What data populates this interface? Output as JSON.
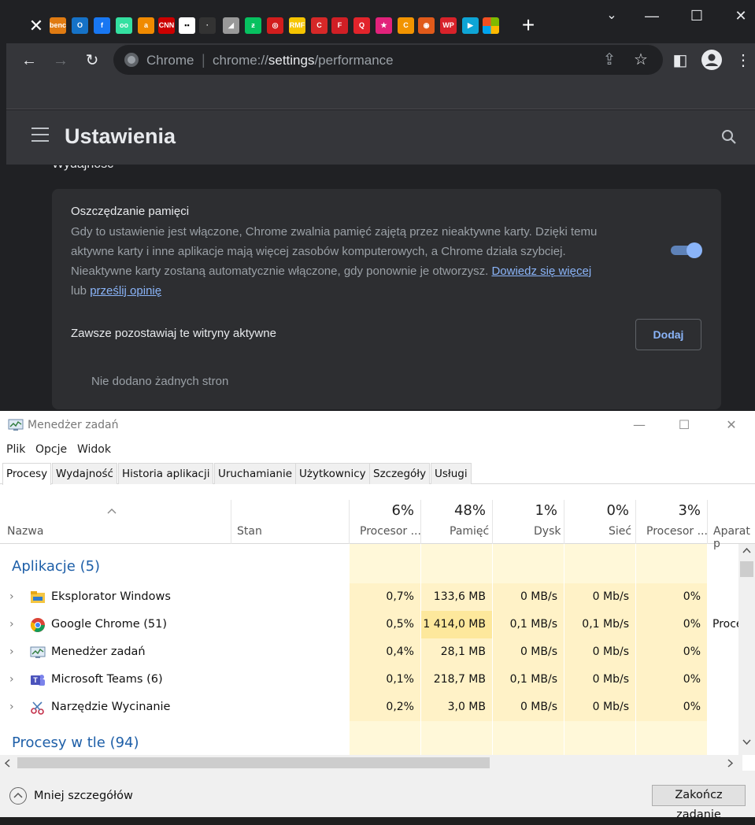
{
  "browser": {
    "window_controls": {
      "dropdown": "⌄",
      "minimize": "—",
      "maximize": "☐",
      "close": "✕"
    },
    "new_tab": "+",
    "tab_close": "✕",
    "tab_favicons": [
      {
        "name": "benchmark-favicon",
        "label": "bench mark",
        "color": "#e07b12"
      },
      {
        "name": "outlook-favicon",
        "label": "O",
        "color": "#1672c7"
      },
      {
        "name": "facebook-favicon",
        "label": "f",
        "color": "#1877f2"
      },
      {
        "name": "tripadvisor-favicon",
        "label": "oo",
        "color": "#34e0a1"
      },
      {
        "name": "amazon-favicon",
        "label": "a",
        "color": "#f08a00"
      },
      {
        "name": "cnn-favicon",
        "label": "CNN",
        "color": "#cc0000"
      },
      {
        "name": "medium-favicon",
        "label": "▪▪",
        "color": "#ffffff"
      },
      {
        "name": "site-favicon-8",
        "label": "·",
        "color": "#333333"
      },
      {
        "name": "site-favicon-9",
        "label": "◢",
        "color": "#999999"
      },
      {
        "name": "site-favicon-10",
        "label": "ƶ",
        "color": "#07c160"
      },
      {
        "name": "radio-favicon",
        "label": "◎",
        "color": "#d21d1d"
      },
      {
        "name": "rmf-favicon",
        "label": "RMF",
        "color": "#f5c400"
      },
      {
        "name": "site-favicon-13",
        "label": "C",
        "color": "#d62828"
      },
      {
        "name": "fakt-favicon",
        "label": "F",
        "color": "#d01f25"
      },
      {
        "name": "site-favicon-15",
        "label": "Q",
        "color": "#e2242b"
      },
      {
        "name": "site-favicon-16",
        "label": "★",
        "color": "#e2227b"
      },
      {
        "name": "site-favicon-17",
        "label": "C",
        "color": "#f29400"
      },
      {
        "name": "site-favicon-18",
        "label": "◉",
        "color": "#e05a1a"
      },
      {
        "name": "wp-favicon",
        "label": "WP",
        "color": "#d8222a"
      },
      {
        "name": "player-favicon",
        "label": "▶",
        "color": "#0ea5d6"
      },
      {
        "name": "microsoft-favicon",
        "label": "",
        "color": "#f25022"
      }
    ],
    "nav": {
      "back": "←",
      "forward": "→",
      "reload": "↻"
    },
    "address": {
      "site_label": "Chrome",
      "separator": "|",
      "scheme": "chrome://",
      "host": "settings",
      "path": "/performance"
    },
    "toolbar_icons": {
      "share": "⇪",
      "star": "☆",
      "sidepanel": "◧",
      "menu": "⋮"
    }
  },
  "settings": {
    "title": "Ustawienia",
    "section_title": "Wydajność",
    "memory_saver": {
      "heading": "Oszczędzanie pamięci",
      "description": "Gdy to ustawienie jest włączone, Chrome zwalnia pamięć zajętą przez nieaktywne karty. Dzięki temu aktywne karty i inne aplikacje mają więcej zasobów komputerowych, a Chrome działa szybciej. Nieaktywne karty zostaną automatycznie włączone, gdy ponownie je otworzysz.",
      "learn_more_link": "Dowiedz się więcej",
      "or_text": "lub",
      "feedback_link": "prześlij opinię",
      "enabled": true
    },
    "always_active": {
      "label": "Zawsze pozostawiaj te witryny aktywne",
      "add_button": "Dodaj",
      "empty_text": "Nie dodano żadnych stron"
    }
  },
  "taskmanager": {
    "title": "Menedżer zadań",
    "window_controls": {
      "minimize": "—",
      "maximize": "☐",
      "close": "✕"
    },
    "menu": [
      "Plik",
      "Opcje",
      "Widok"
    ],
    "tabs": [
      "Procesy",
      "Wydajność",
      "Historia aplikacji",
      "Uruchamianie",
      "Użytkownicy",
      "Szczegóły",
      "Usługi"
    ],
    "active_tab": "Procesy",
    "columns": {
      "name": "Nazwa",
      "status": "Stan",
      "cpu_pct": "6%",
      "cpu": "Procesor ...",
      "mem_pct": "48%",
      "mem": "Pamięć",
      "disk_pct": "1%",
      "disk": "Dysk",
      "net_pct": "0%",
      "net": "Sieć",
      "gpu_pct": "3%",
      "gpu": "Procesor ...",
      "gpu_engine": "Aparat p"
    },
    "groups": {
      "apps": "Aplikacje (5)",
      "background": "Procesy w tle (94)"
    },
    "apps": [
      {
        "name": "Eksplorator Windows",
        "cpu": "0,7%",
        "mem": "133,6 MB",
        "disk": "0 MB/s",
        "net": "0 Mb/s",
        "gpu": "0%",
        "gpu_engine": ""
      },
      {
        "name": "Google Chrome (51)",
        "cpu": "0,5%",
        "mem": "1 414,0 MB",
        "disk": "0,1 MB/s",
        "net": "0,1 Mb/s",
        "gpu": "0%",
        "gpu_engine": "Proce"
      },
      {
        "name": "Menedżer zadań",
        "cpu": "0,4%",
        "mem": "28,1 MB",
        "disk": "0 MB/s",
        "net": "0 Mb/s",
        "gpu": "0%",
        "gpu_engine": ""
      },
      {
        "name": "Microsoft Teams (6)",
        "cpu": "0,1%",
        "mem": "218,7 MB",
        "disk": "0,1 MB/s",
        "net": "0 Mb/s",
        "gpu": "0%",
        "gpu_engine": ""
      },
      {
        "name": "Narzędzie Wycinanie",
        "cpu": "0,2%",
        "mem": "3,0 MB",
        "disk": "0 MB/s",
        "net": "0 Mb/s",
        "gpu": "0%",
        "gpu_engine": ""
      }
    ],
    "footer": {
      "less_details": "Mniej szczegółów",
      "end_task": "Zakończ zadanie"
    }
  }
}
